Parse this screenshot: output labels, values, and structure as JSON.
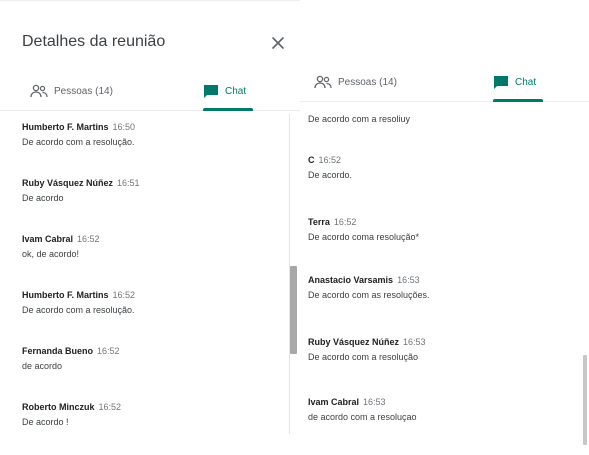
{
  "left_panel": {
    "title": "Detalhes da reunião",
    "tabs": [
      {
        "label": "Pessoas (14)",
        "active": false
      },
      {
        "label": "Chat",
        "active": true
      }
    ],
    "messages": [
      {
        "sender": "Humberto F. Martins",
        "time": "16:50",
        "text": "De acordo com a resolução."
      },
      {
        "sender": "Ruby Vásquez Núñez",
        "time": "16:51",
        "text": "De acordo"
      },
      {
        "sender": "Ivam Cabral",
        "time": "16:52",
        "text": "ok, de acordo!"
      },
      {
        "sender": "Humberto F. Martins",
        "time": "16:52",
        "text": "De acordo com a resolução."
      },
      {
        "sender": "Fernanda Bueno",
        "time": "16:52",
        "text": "de acordo"
      },
      {
        "sender": "Roberto Minczuk",
        "time": "16:52",
        "text": "De acordo !"
      }
    ]
  },
  "right_panel": {
    "tabs": [
      {
        "label": "Pessoas (14)",
        "active": false
      },
      {
        "label": "Chat",
        "active": true
      }
    ],
    "messages": [
      {
        "sender": "",
        "time": "",
        "text": "De acordo com a resoliuy"
      },
      {
        "sender": "C",
        "time": "16:52",
        "text": "De acordo."
      },
      {
        "sender": "Terra",
        "time": "16:52",
        "text": "De acordo coma resolução*"
      },
      {
        "sender": "Anastacio Varsamis",
        "time": "16:53",
        "text": "De acordo com as resoluções."
      },
      {
        "sender": "Ruby Vásquez Núñez",
        "time": "16:53",
        "text": "De acordo com a resolução"
      },
      {
        "sender": "Ivam Cabral",
        "time": "16:53",
        "text": "de acordo com a resoluçao"
      }
    ]
  },
  "colors": {
    "accent": "#00796b",
    "text_primary": "#202124",
    "text_secondary": "#5f6368"
  },
  "icons": {
    "close": "close-icon",
    "people": "people-icon",
    "chat": "chat-icon"
  }
}
